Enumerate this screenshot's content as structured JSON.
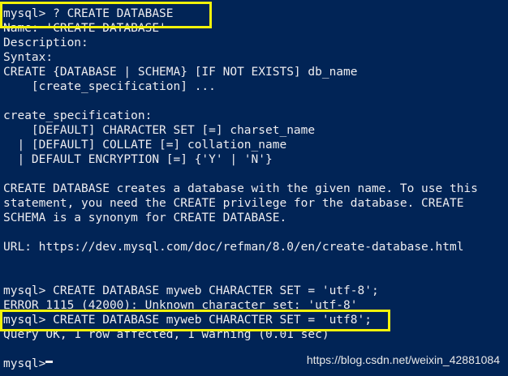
{
  "terminal": {
    "lines": [
      "mysql> ? CREATE DATABASE",
      "Name: 'CREATE DATABASE'",
      "Description:",
      "Syntax:",
      "CREATE {DATABASE | SCHEMA} [IF NOT EXISTS] db_name",
      "    [create_specification] ...",
      "",
      "create_specification:",
      "    [DEFAULT] CHARACTER SET [=] charset_name",
      "  | [DEFAULT] COLLATE [=] collation_name",
      "  | DEFAULT ENCRYPTION [=] {'Y' | 'N'}",
      "",
      "CREATE DATABASE creates a database with the given name. To use this",
      "statement, you need the CREATE privilege for the database. CREATE",
      "SCHEMA is a synonym for CREATE DATABASE.",
      "",
      "URL: https://dev.mysql.com/doc/refman/8.0/en/create-database.html",
      "",
      "",
      "mysql> CREATE DATABASE myweb CHARACTER SET = 'utf-8';",
      "ERROR 1115 (42000): Unknown character set: 'utf-8'",
      "mysql> CREATE DATABASE myweb CHARACTER SET = 'utf8';",
      "Query OK, 1 row affected, 1 warning (0.01 sec)",
      "",
      "mysql>"
    ]
  },
  "watermark": "https://blog.csdn.net/weixin_42881084",
  "colors": {
    "background": "#012456",
    "text": "#eeedf0",
    "highlight": "#f2f20a"
  }
}
